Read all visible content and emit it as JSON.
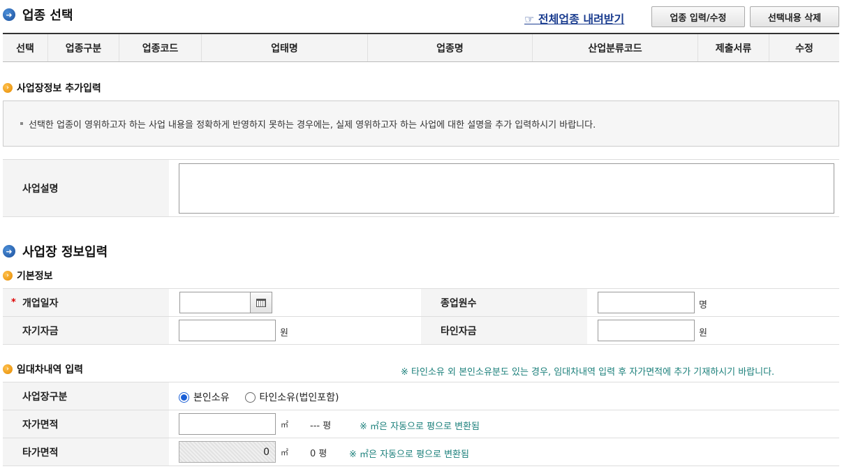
{
  "industry": {
    "title": "업종 선택",
    "download_link": "☞ 전체업종 내려받기",
    "btn_edit": "업종 입력/수정",
    "btn_delete": "선택내용 삭제",
    "columns": [
      "선택",
      "업종구분",
      "업종코드",
      "업태명",
      "업종명",
      "산업분류코드",
      "제출서류",
      "수정"
    ]
  },
  "extra": {
    "title": "사업장정보 추가입력",
    "notice": "선택한 업종이 영위하고자 하는 사업 내용을 정확하게 반영하지 못하는 경우에는, 실제 영위하고자 하는 사업에 대한 설명을 추가 입력하시기 바랍니다.",
    "desc_label": "사업설명",
    "desc_value": ""
  },
  "business": {
    "title": "사업장 정보입력",
    "basic_title": "기본정보",
    "open_date_label": "개업일자",
    "open_date_value": "",
    "employees_label": "종업원수",
    "employees_value": "",
    "employees_unit": "명",
    "own_fund_label": "자기자금",
    "own_fund_value": "",
    "own_fund_unit": "원",
    "other_fund_label": "타인자금",
    "other_fund_value": "",
    "other_fund_unit": "원"
  },
  "lease": {
    "title": "임대차내역 입력",
    "note": "※ 타인소유 외 본인소유분도 있는 경우, 임대차내역 입력 후 자가면적에 추가 기재하시기 바랍니다.",
    "type_label": "사업장구분",
    "option_own": "본인소유",
    "option_other": "타인소유(법인포함)",
    "own_area_label": "자가면적",
    "own_area_value": "",
    "own_area_unit": "㎡",
    "own_area_pyeong": "--- 평",
    "other_area_label": "타가면적",
    "other_area_value": "0",
    "other_area_unit": "㎡",
    "other_area_pyeong": "0 평",
    "convert_note": "※ ㎡은 자동으로 평으로 변환됨"
  },
  "icons": {
    "section": "arrow-circle-icon",
    "subsection": "arrow-circle-small-icon",
    "calendar": "calendar-icon"
  }
}
